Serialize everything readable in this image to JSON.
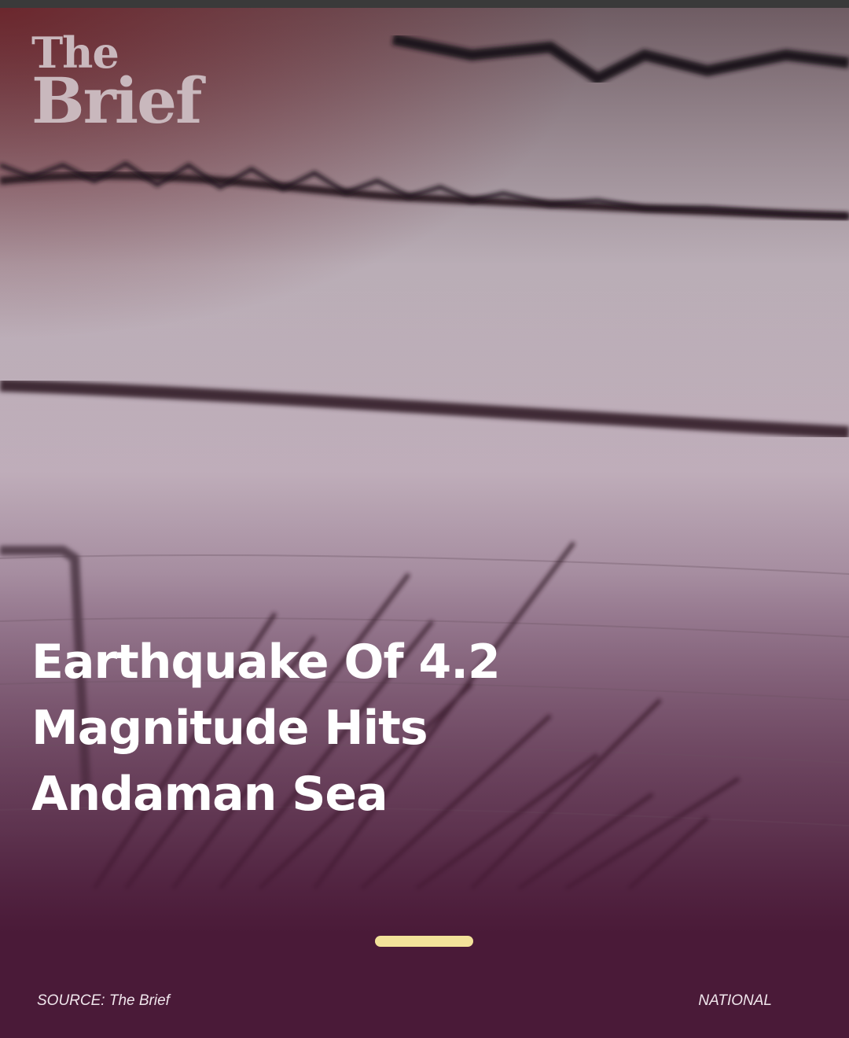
{
  "brand": {
    "line1": "The",
    "line2": "Brief"
  },
  "story": {
    "headline": "Earthquake Of 4.2 Magnitude Hits Andaman Sea",
    "progress": 1.0
  },
  "footer": {
    "source": "SOURCE: The Brief",
    "category": "NATIONAL"
  },
  "colors": {
    "overlay": "#4a1a38",
    "accent_pill": "#f3e29a",
    "text": "#ffffff"
  }
}
